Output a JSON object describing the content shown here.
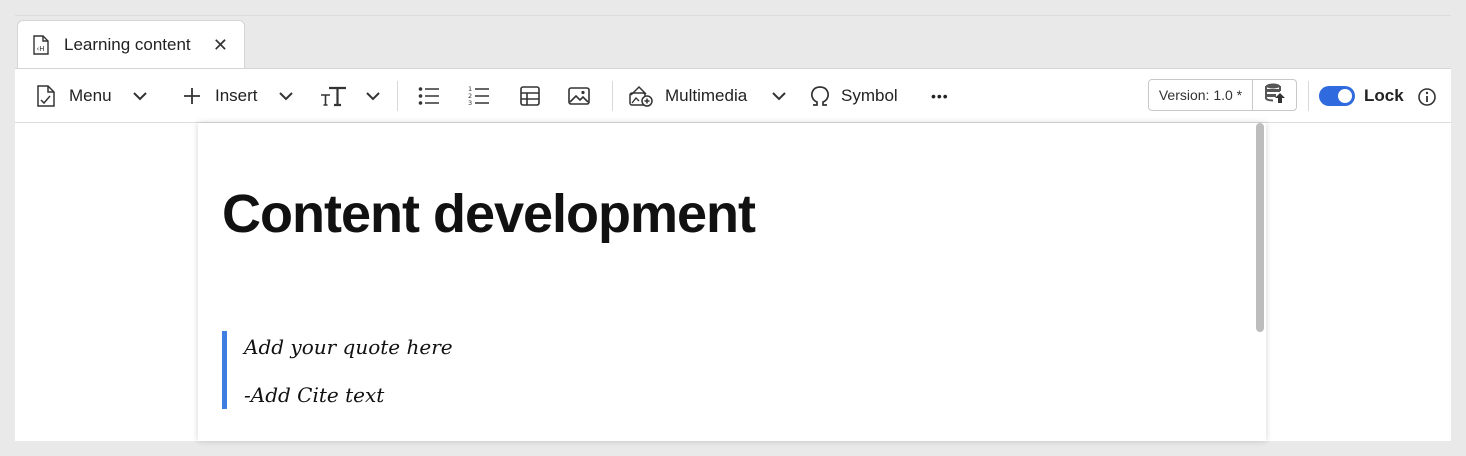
{
  "tab": {
    "title": "Learning content",
    "close": "✕"
  },
  "toolbar": {
    "menu_label": "Menu",
    "insert_label": "Insert",
    "multimedia_label": "Multimedia",
    "symbol_label": "Symbol",
    "more_label": "•••",
    "version_label": "Version: 1.0 *",
    "lock_label": "Lock",
    "lock_enabled": true
  },
  "document": {
    "title": "Content development",
    "quote_text": "Add your quote here",
    "cite_text": "-Add Cite text"
  },
  "colors": {
    "accent": "#2f6bde",
    "quote_border": "#3f7de0",
    "background": "#e9e9e9"
  }
}
